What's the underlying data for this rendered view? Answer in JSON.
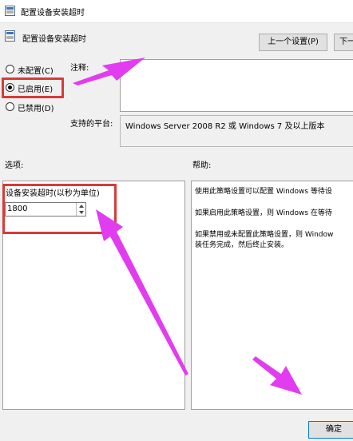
{
  "window": {
    "title": "配置设备安装超时"
  },
  "policy": {
    "heading": "配置设备安装超时"
  },
  "nav": {
    "prev_button": "上一个设置(P)",
    "next_button": "下一"
  },
  "state_options": [
    {
      "label": "未配置(C)",
      "selected": false
    },
    {
      "label": "已启用(E)",
      "selected": true
    },
    {
      "label": "已禁用(D)",
      "selected": false
    }
  ],
  "comment": {
    "label": "注释:",
    "value": ""
  },
  "platform": {
    "label": "支持的平台:",
    "value": "Windows Server 2008 R2 或 Windows 7 及以上版本"
  },
  "options": {
    "label": "选项:",
    "timeout_label": "设备安装超时(以秒为单位)",
    "timeout_value": "1800"
  },
  "help": {
    "label": "帮助:",
    "paragraphs": [
      "使用此策略设置可以配置 Windows 等待设",
      "如果启用此策略设置，则 Windows 在等待",
      "如果禁用或未配置此策略设置，则 Window",
      "装任务完成，然后终止安装。"
    ]
  },
  "footer": {
    "ok_button": "确定"
  },
  "colors": {
    "annotation_arrow": "#e23cf0",
    "annotation_box": "#d83a3a"
  }
}
